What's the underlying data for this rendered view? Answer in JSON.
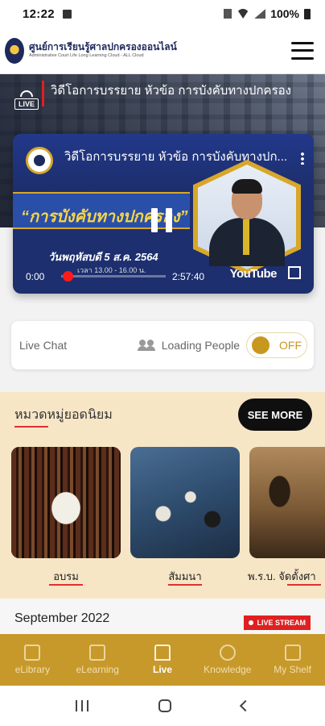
{
  "status_bar": {
    "time": "12:22",
    "battery": "100%"
  },
  "header": {
    "brand_title": "ศูนย์การเรียนรู้ศาลปกครองออนไลน์",
    "brand_subtitle": "Administrative Court Life Long Learning Cloud - ALL Cloud",
    "menu_icon": "hamburger-menu-icon"
  },
  "hero": {
    "live_label": "LIVE",
    "title": "วิดีโอการบรรยาย หัวข้อ การบังคับทางปกครอง"
  },
  "video": {
    "title": "วิดีโอการบรรยาย หัวข้อ การบังคับทางปก...",
    "headline": "“การบังคับทางปกครอง”",
    "date_text": "วันพฤหัสบดี 5 ส.ค. 2564",
    "time_range": "เวลา 13.00 - 16.00 น.",
    "current_time": "0:00",
    "duration": "2:57:40",
    "progress": 0,
    "brand": "YouTube"
  },
  "live_chat": {
    "label": "Live Chat",
    "people_label": "Loading People",
    "toggle_label": "OFF",
    "toggle_on": false
  },
  "popular": {
    "heading": "หมวดหมู่ยอดนิยม",
    "see_more": "SEE MORE",
    "categories": [
      {
        "label": "อบรม"
      },
      {
        "label": "สัมมนา"
      },
      {
        "label": "พ.ร.บ. จัดตั้งศา"
      }
    ]
  },
  "schedule": {
    "month": "September 2022",
    "live_stream_label": "LIVE STREAM"
  },
  "bottom_nav": {
    "items": [
      {
        "label": "eLibrary",
        "icon": "book-icon"
      },
      {
        "label": "eLearning",
        "icon": "graduation-cap-icon"
      },
      {
        "label": "Live",
        "icon": "live-broadcast-icon"
      },
      {
        "label": "Knowledge",
        "icon": "lightbulb-icon"
      },
      {
        "label": "My Shelf",
        "icon": "bookshelf-icon"
      }
    ],
    "active": "Live"
  },
  "colors": {
    "gold": "#c7992a",
    "cream": "#f7e6c6",
    "accent_red": "#e02020",
    "navy": "#1e2a5c"
  }
}
